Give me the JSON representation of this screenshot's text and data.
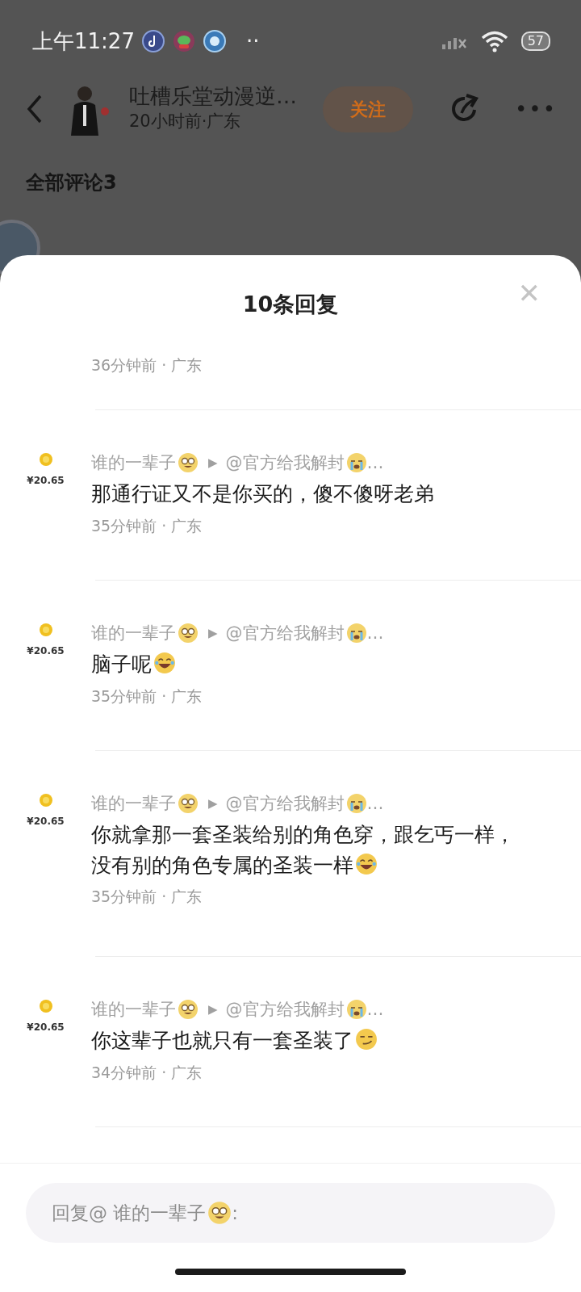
{
  "status_bar": {
    "time": "上午11:27",
    "more": "··",
    "battery": "57"
  },
  "post_header": {
    "author": "吐槽乐堂动漫逆…",
    "meta": "20小时前·广东",
    "follow_button": "关注",
    "more_button": "•••"
  },
  "comments_heading": "全部评论3",
  "reply_sheet": {
    "title": "10条回复",
    "close_button": "✕",
    "first_time": "36分钟前 · 广东",
    "replies": [
      {
        "user": "谁的一辈子",
        "user_emoji": {
          "kind": "nerd"
        },
        "arrow": "▶",
        "reply_to": "@官方给我解封",
        "reply_to_emoji": {
          "kind": "crying"
        },
        "ellipsis": "…",
        "badge_value": "¥20.65",
        "text": "那通行证又不是你买的，傻不傻呀老弟",
        "time": "35分钟前 · 广东"
      },
      {
        "user": "谁的一辈子",
        "user_emoji": {
          "kind": "nerd"
        },
        "arrow": "▶",
        "reply_to": "@官方给我解封",
        "reply_to_emoji": {
          "kind": "crying"
        },
        "ellipsis": "…",
        "badge_value": "¥20.65",
        "text": "脑子呢",
        "text_emoji": {
          "kind": "laughing"
        },
        "time": "35分钟前 · 广东"
      },
      {
        "user": "谁的一辈子",
        "user_emoji": {
          "kind": "nerd"
        },
        "arrow": "▶",
        "reply_to": "@官方给我解封",
        "reply_to_emoji": {
          "kind": "crying"
        },
        "ellipsis": "…",
        "badge_value": "¥20.65",
        "text": "你就拿那一套圣装给别的角色穿，跟乞丐一样，没有别的角色专属的圣装一样",
        "text_emoji": {
          "kind": "laughing"
        },
        "time": "35分钟前 · 广东"
      },
      {
        "user": "谁的一辈子",
        "user_emoji": {
          "kind": "nerd"
        },
        "arrow": "▶",
        "reply_to": "@官方给我解封",
        "reply_to_emoji": {
          "kind": "crying"
        },
        "ellipsis": "…",
        "badge_value": "¥20.65",
        "text": "你这辈子也就只有一套圣装了",
        "text_emoji": {
          "kind": "smirk"
        },
        "time": "34分钟前 · 广东"
      }
    ],
    "reply_box": {
      "placeholder": "回复@ 谁的一辈子",
      "placeholder_emoji": {
        "kind": "nerd"
      },
      "placeholder_end": ":"
    }
  }
}
